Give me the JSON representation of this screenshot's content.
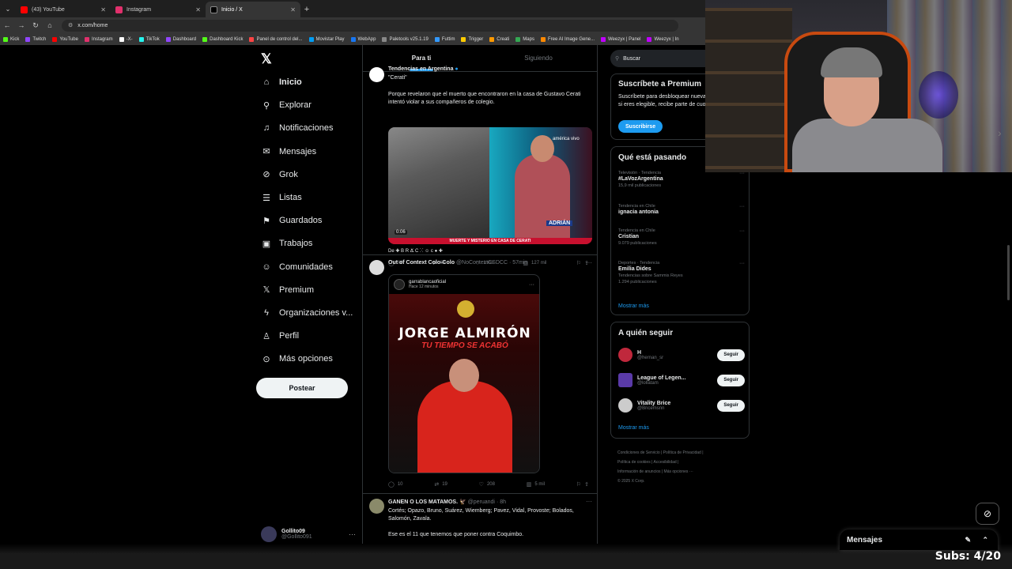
{
  "tabs": [
    {
      "label": "(43) YouTube",
      "color": "#ff0000"
    },
    {
      "label": "Instagram",
      "color": "#e1306c"
    },
    {
      "label": "Inicio / X",
      "color": "#000000"
    }
  ],
  "address": {
    "url": "x.com/home"
  },
  "bookmarks": [
    {
      "label": "Kick",
      "color": "#53fc18"
    },
    {
      "label": "Twitch",
      "color": "#9146ff"
    },
    {
      "label": "YouTube",
      "color": "#ff0000"
    },
    {
      "label": "Instagram",
      "color": "#e1306c"
    },
    {
      "label": "-X-",
      "color": "#ffffff"
    },
    {
      "label": "TikTok",
      "color": "#25f4ee"
    },
    {
      "label": "Dashboard",
      "color": "#9146ff"
    },
    {
      "label": "Dashboard Kick",
      "color": "#53fc18"
    },
    {
      "label": "Panel de control del...",
      "color": "#ff4444"
    },
    {
      "label": "Movistar Play",
      "color": "#019df4"
    },
    {
      "label": "WebApp",
      "color": "#1877f2"
    },
    {
      "label": "Paletools v25.1.19",
      "color": "#888888"
    },
    {
      "label": "Futtim",
      "color": "#3399ff"
    },
    {
      "label": "Trigger",
      "color": "#ffcc00"
    },
    {
      "label": "Creati",
      "color": "#ff9900"
    },
    {
      "label": "Maps",
      "color": "#34a853"
    },
    {
      "label": "Free AI Image Gene...",
      "color": "#ff8800"
    },
    {
      "label": "Weezyx | Panel",
      "color": "#c000ff"
    },
    {
      "label": "Weezyx | In",
      "color": "#c000ff"
    }
  ],
  "nav": {
    "items": [
      {
        "label": "Inicio",
        "icon": "home-icon",
        "glyph": "⌂"
      },
      {
        "label": "Explorar",
        "icon": "search-icon",
        "glyph": "⚲"
      },
      {
        "label": "Notificaciones",
        "icon": "bell-icon",
        "glyph": "♫"
      },
      {
        "label": "Mensajes",
        "icon": "envelope-icon",
        "glyph": "✉"
      },
      {
        "label": "Grok",
        "icon": "grok-icon",
        "glyph": "⊘"
      },
      {
        "label": "Listas",
        "icon": "list-icon",
        "glyph": "☰"
      },
      {
        "label": "Guardados",
        "icon": "bookmark-icon",
        "glyph": "⚑"
      },
      {
        "label": "Trabajos",
        "icon": "briefcase-icon",
        "glyph": "▣"
      },
      {
        "label": "Comunidades",
        "icon": "people-icon",
        "glyph": "☺"
      },
      {
        "label": "Premium",
        "icon": "x-icon",
        "glyph": "𝕏"
      },
      {
        "label": "Organizaciones v...",
        "icon": "lightning-icon",
        "glyph": "ϟ"
      },
      {
        "label": "Perfil",
        "icon": "person-icon",
        "glyph": "♙"
      },
      {
        "label": "Más opciones",
        "icon": "more-circle-icon",
        "glyph": "⊙"
      }
    ],
    "post_label": "Postear"
  },
  "user": {
    "name": "Gollito09",
    "handle": "@Gollito091"
  },
  "feed": {
    "tabs": [
      "Para ti",
      "Siguiendo"
    ],
    "posts": [
      {
        "header": "Tendencias en Argentina",
        "quote": "\"Cerati\"",
        "text": "Porque revelaron que el muerto que encontraron en la casa de Gustavo Cerati intentó violar a sus compañeros de colegio.",
        "video_duration": "0:06",
        "banner": "MUERTE Y MISTERIO EN CASA DE CERATI",
        "tag": "ADRIÁN",
        "channel": "américa vivo",
        "emoji_line": "De ✚ B R Ճ C ⵘ ☺ c ● ✚",
        "replies": "64",
        "reposts": "54",
        "likes": "1 mil",
        "views": "127 mil"
      },
      {
        "name": "Out of Context Colo-Colo",
        "handle": "@NoContextCSDCC",
        "time": "· 57min",
        "quote_name": "garrablancaoficial",
        "quote_time": "Hace 12 minutos",
        "poster_title": "JORGE ALMIRÓN",
        "poster_sub": "TU TIEMPO SE ACABÓ",
        "replies": "10",
        "reposts": "19",
        "likes": "208",
        "views": "5 mil"
      },
      {
        "name": "GANEN O LOS MATAMOS. 🦅",
        "handle": "@peruandi",
        "time": "· 8h",
        "text": "Cortés; Opazo, Bruno, Suárez, Wiemberg; Pavez, Vidal, Provoste; Bolados, Salomón, Zavala.",
        "text2": "Ese es el 11 que tenemos que poner contra Coquimbo."
      }
    ]
  },
  "right": {
    "search_placeholder": "Buscar",
    "premium": {
      "title": "Suscríbete a Premium",
      "text": "Suscríbete para desbloquear nuevas funciones y, si eres elegible, recibe parte de cuota de Ingresos.",
      "button": "Suscribirse"
    },
    "trends_title": "Qué está pasando",
    "trends": [
      {
        "context": "Televisión · Tendencia",
        "topic": "#LaVozArgentina",
        "count": "15,9 mil publicaciones"
      },
      {
        "context": "Tendencia en Chile",
        "topic": "ignacia antonia",
        "count": ""
      },
      {
        "context": "Tendencia en Chile",
        "topic": "Cristian",
        "count": "9.079 publicaciones"
      },
      {
        "context": "Deportes · Tendencia",
        "topic": "Emilia Dides",
        "count": "Tendencias sobre Sammis Reyes",
        "count2": "1.294 publicaciones"
      }
    ],
    "show_more": "Mostrar más",
    "follow_title": "A quién seguir",
    "follow": [
      {
        "name": "H",
        "handle": "@hernan_sr",
        "color": "#c0283c"
      },
      {
        "name": "League of Legen...",
        "handle": "@lollatam",
        "color": "#5a3aa8"
      },
      {
        "name": "Vitality Brice",
        "handle": "@Bricemsnn",
        "color": "#cccccc"
      }
    ],
    "follow_button": "Seguir",
    "footer": [
      "Condiciones de Servicio | Política de Privacidad |",
      "Política de cookies | Accesibilidad |",
      "Información de anuncios | Más opciones ···",
      "© 2025 X Corp."
    ]
  },
  "messages_label": "Mensajes",
  "overlay": {
    "subs": "Subs: 4/20"
  }
}
